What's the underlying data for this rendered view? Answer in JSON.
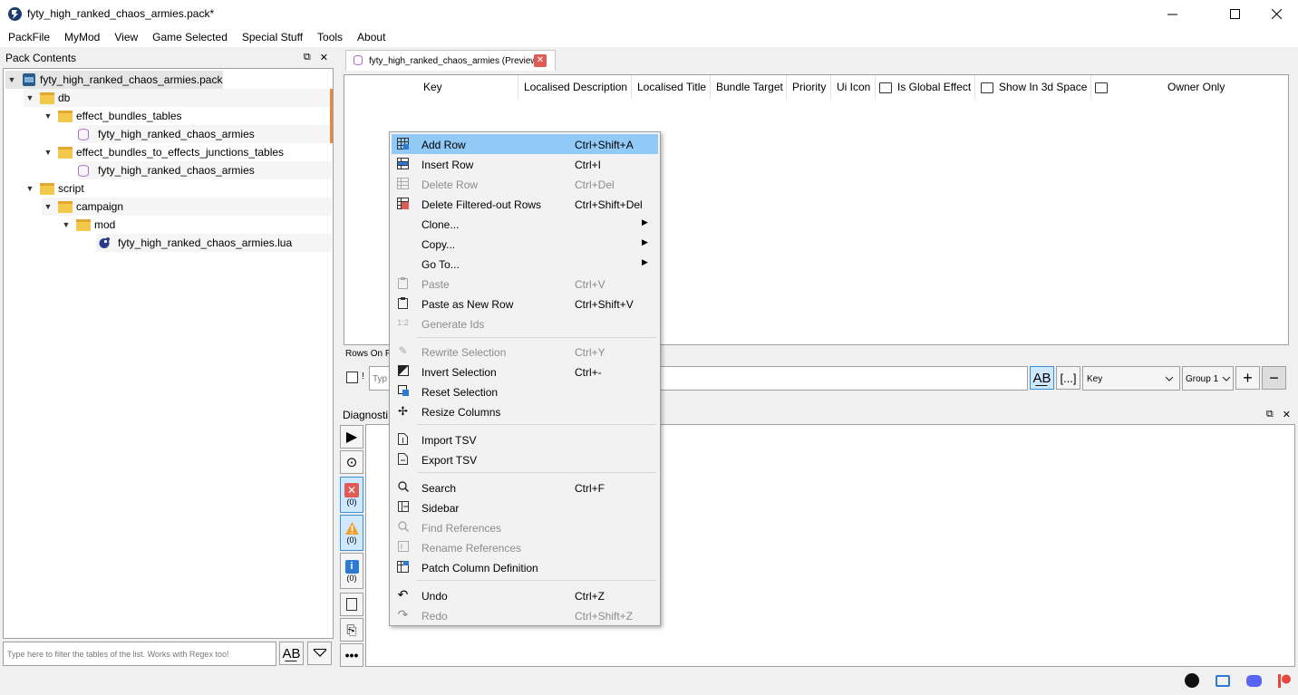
{
  "window": {
    "title": "fyty_high_ranked_chaos_armies.pack*",
    "controls": {
      "minimize": "—",
      "maximize": "☐",
      "close": "✕"
    }
  },
  "menubar": [
    "PackFile",
    "MyMod",
    "View",
    "Game Selected",
    "Special Stuff",
    "Tools",
    "About"
  ],
  "pack_contents": {
    "title": "Pack Contents",
    "tree": [
      {
        "label": "fyty_high_ranked_chaos_armies.pack",
        "icon": "pack-icon",
        "arrow": "▼"
      },
      {
        "label": "db",
        "icon": "folder-icon",
        "arrow": "▼"
      },
      {
        "label": "effect_bundles_tables",
        "icon": "folder-icon",
        "arrow": "▼"
      },
      {
        "label": "fyty_high_ranked_chaos_armies",
        "icon": "table-icon",
        "arrow": ""
      },
      {
        "label": "effect_bundles_to_effects_junctions_tables",
        "icon": "folder-icon",
        "arrow": "▼"
      },
      {
        "label": "fyty_high_ranked_chaos_armies",
        "icon": "table-icon",
        "arrow": ""
      },
      {
        "label": "script",
        "icon": "folder-icon",
        "arrow": "▼"
      },
      {
        "label": "campaign",
        "icon": "folder-icon",
        "arrow": "▼"
      },
      {
        "label": "mod",
        "icon": "folder-icon",
        "arrow": "▼"
      },
      {
        "label": "fyty_high_ranked_chaos_armies.lua",
        "icon": "lua-icon",
        "arrow": ""
      }
    ],
    "filter_placeholder": "Type here to filter the tables of the list. Works with Regex too!"
  },
  "tab": {
    "label": "fyty_high_ranked_chaos_armies (Preview)"
  },
  "table": {
    "columns": [
      "Key",
      "Localised Description",
      "Localised Title",
      "Bundle Target",
      "Priority",
      "Ui Icon",
      "Is Global Effect",
      "Show In 3d Space",
      "Owner Only"
    ],
    "rows_on_filter": "Rows On F",
    "filter_placeholder": "Typ",
    "filter_column": "Key",
    "filter_group": "Group 1"
  },
  "diagnostics": {
    "title": "Diagnosti",
    "counts": {
      "errors": "(0)",
      "warnings": "(0)",
      "info": "(0)"
    }
  },
  "context_menu": [
    {
      "label": "Add Row",
      "shortcut": "Ctrl+Shift+A",
      "icon": "add-row-icon",
      "enabled": true,
      "highlighted": true
    },
    {
      "label": "Insert Row",
      "shortcut": "Ctrl+I",
      "icon": "insert-row-icon",
      "enabled": true
    },
    {
      "label": "Delete Row",
      "shortcut": "Ctrl+Del",
      "icon": "delete-row-icon",
      "enabled": false
    },
    {
      "label": "Delete Filtered-out Rows",
      "shortcut": "Ctrl+Shift+Del",
      "icon": "delete-filtered-icon",
      "enabled": true
    },
    {
      "label": "Clone...",
      "shortcut": "",
      "icon": "",
      "enabled": true,
      "submenu": true
    },
    {
      "label": "Copy...",
      "shortcut": "",
      "icon": "",
      "enabled": true,
      "submenu": true
    },
    {
      "label": "Go To...",
      "shortcut": "",
      "icon": "",
      "enabled": true,
      "submenu": true
    },
    {
      "label": "Paste",
      "shortcut": "Ctrl+V",
      "icon": "paste-icon",
      "enabled": false
    },
    {
      "label": "Paste as New Row",
      "shortcut": "Ctrl+Shift+V",
      "icon": "paste-new-row-icon",
      "enabled": true
    },
    {
      "label": "Generate Ids",
      "shortcut": "",
      "icon": "generate-ids-icon",
      "enabled": false
    },
    {
      "label": "Rewrite Selection",
      "shortcut": "Ctrl+Y",
      "icon": "pencil-icon",
      "enabled": false
    },
    {
      "label": "Invert Selection",
      "shortcut": "Ctrl+-",
      "icon": "invert-selection-icon",
      "enabled": true
    },
    {
      "label": "Reset Selection",
      "shortcut": "",
      "icon": "reset-selection-icon",
      "enabled": true
    },
    {
      "label": "Resize Columns",
      "shortcut": "",
      "icon": "resize-columns-icon",
      "enabled": true
    },
    {
      "label": "Import TSV",
      "shortcut": "",
      "icon": "import-icon",
      "enabled": true
    },
    {
      "label": "Export TSV",
      "shortcut": "",
      "icon": "export-icon",
      "enabled": true
    },
    {
      "label": "Search",
      "shortcut": "Ctrl+F",
      "icon": "search-icon",
      "enabled": true
    },
    {
      "label": "Sidebar",
      "shortcut": "",
      "icon": "sidebar-icon",
      "enabled": true
    },
    {
      "label": "Find References",
      "shortcut": "",
      "icon": "search-icon",
      "enabled": false
    },
    {
      "label": "Rename References",
      "shortcut": "",
      "icon": "rename-icon",
      "enabled": false
    },
    {
      "label": "Patch Column Definition",
      "shortcut": "",
      "icon": "patch-icon",
      "enabled": true
    },
    {
      "label": "Undo",
      "shortcut": "Ctrl+Z",
      "icon": "undo-icon",
      "enabled": true
    },
    {
      "label": "Redo",
      "shortcut": "Ctrl+Shift+Z",
      "icon": "redo-icon",
      "enabled": false
    }
  ],
  "colors": {
    "highlight": "#91c9f7",
    "folder": "#f2c94c",
    "error": "#e05b55",
    "warning": "#f0a030",
    "info": "#2b7ad6"
  }
}
